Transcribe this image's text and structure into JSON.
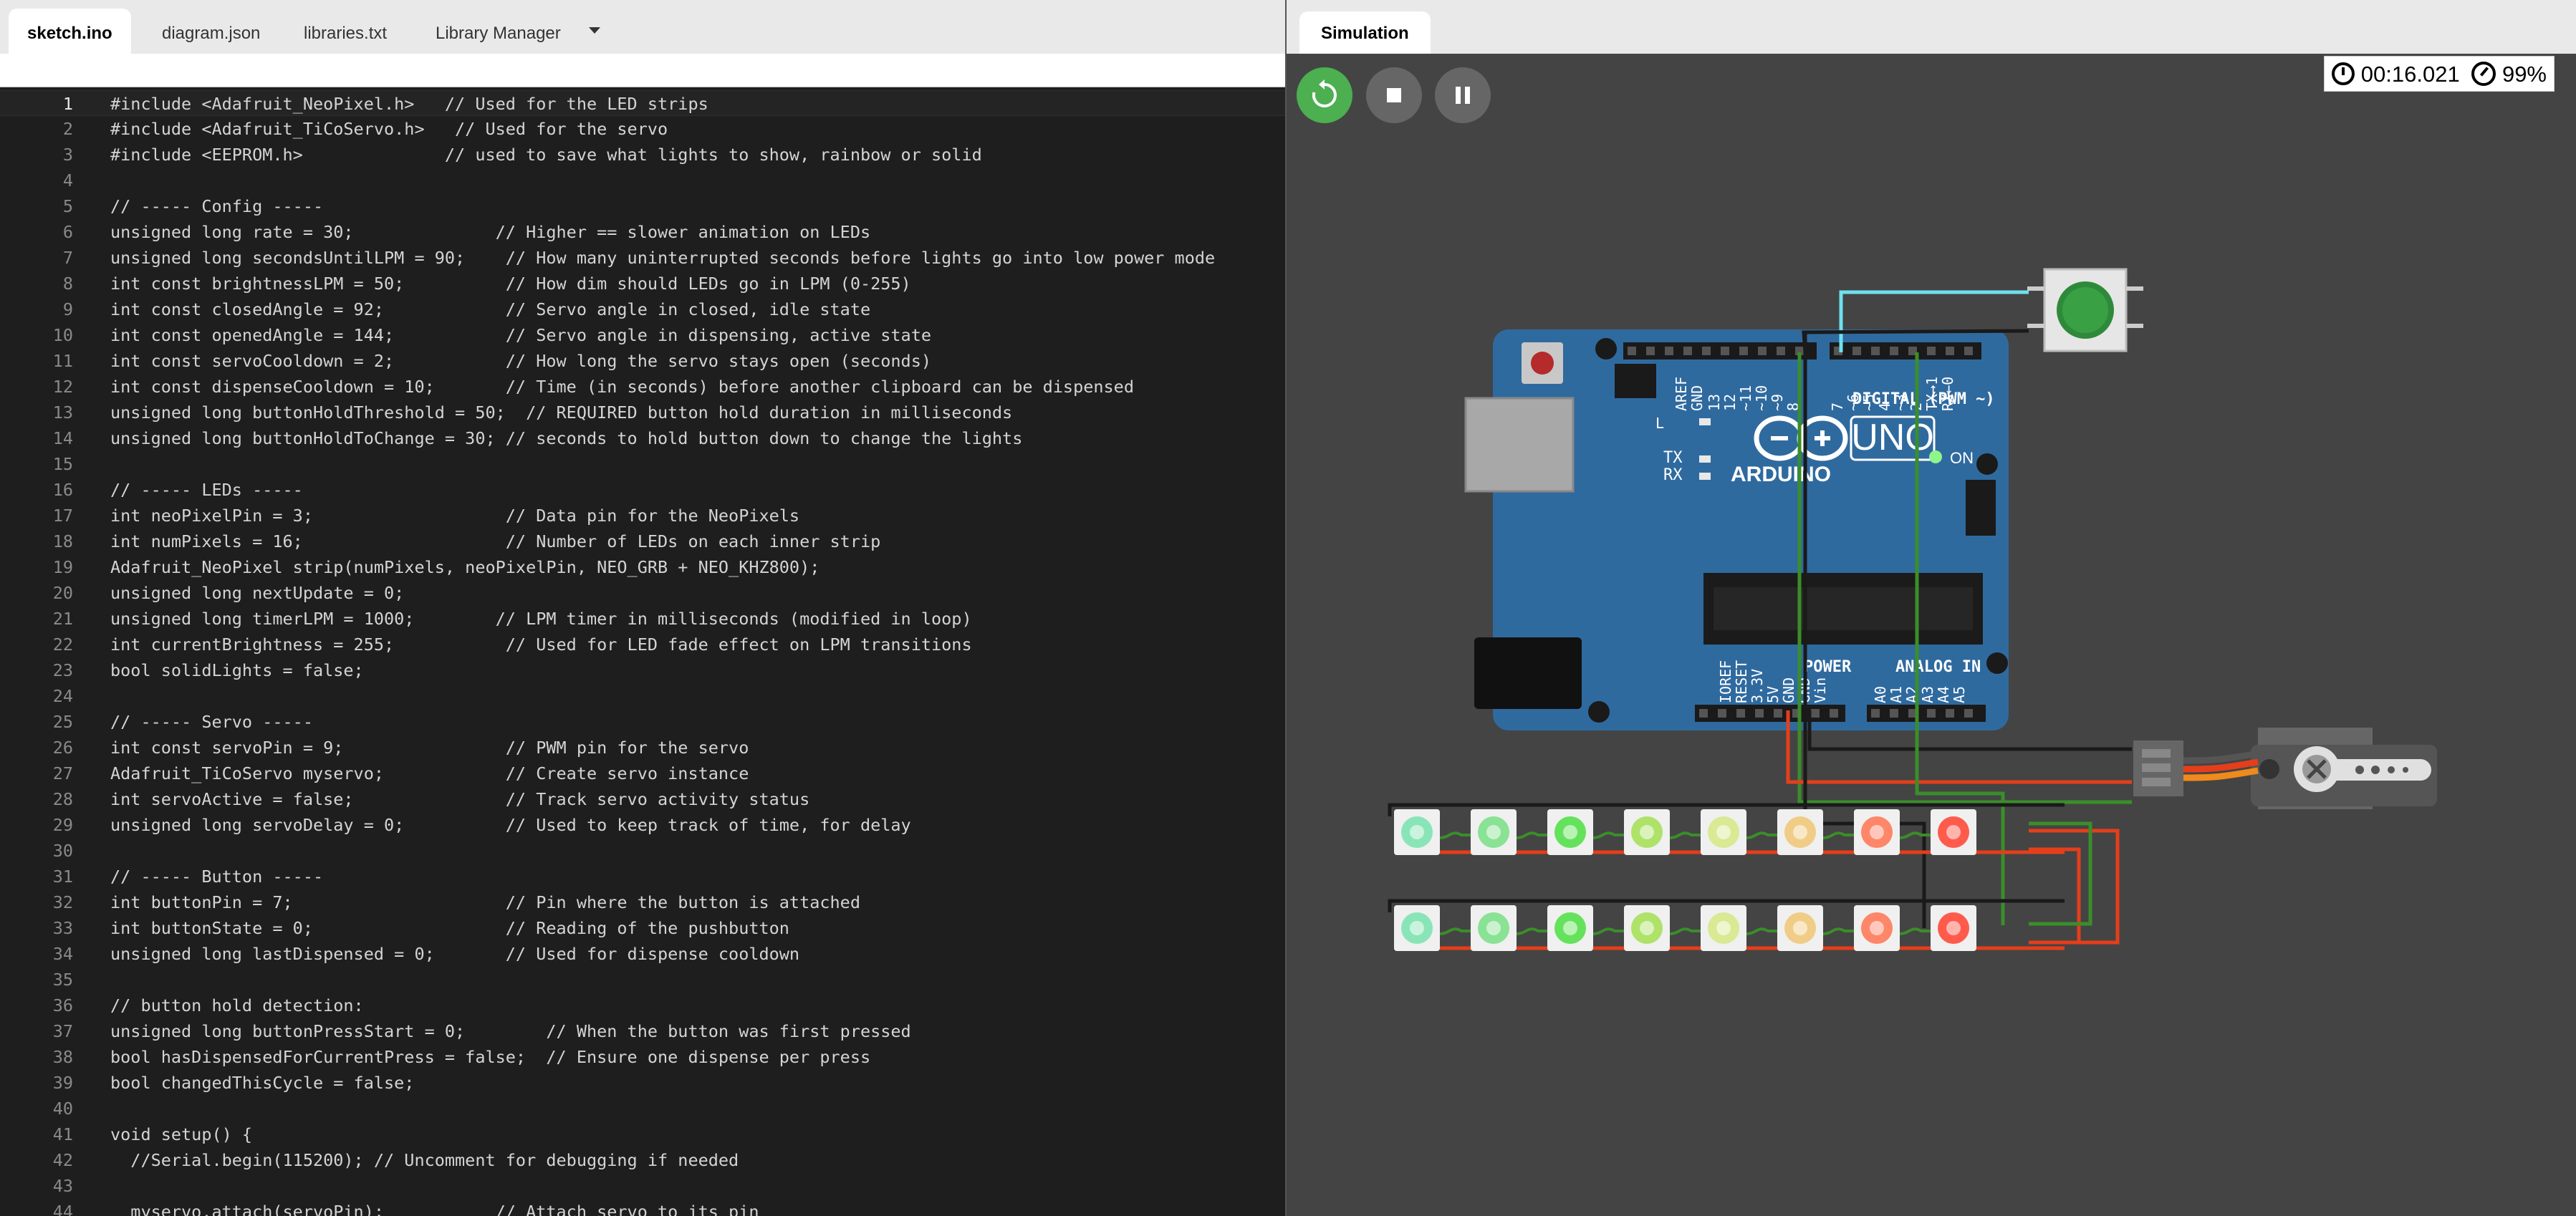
{
  "editor": {
    "tabs": [
      "sketch.ino",
      "diagram.json",
      "libraries.txt",
      "Library Manager"
    ],
    "active_tab": 0,
    "current_line": 1,
    "lines": [
      {
        "n": "1",
        "t": "#include <Adafruit_NeoPixel.h>   // Used for the LED strips"
      },
      {
        "n": "2",
        "t": "#include <Adafruit_TiCoServo.h>   // Used for the servo"
      },
      {
        "n": "3",
        "t": "#include <EEPROM.h>              // used to save what lights to show, rainbow or solid"
      },
      {
        "n": "4",
        "t": ""
      },
      {
        "n": "5",
        "t": "// ----- Config -----"
      },
      {
        "n": "6",
        "t": "unsigned long rate = 30;              // Higher == slower animation on LEDs"
      },
      {
        "n": "7",
        "t": "unsigned long secondsUntilLPM = 90;    // How many uninterrupted seconds before lights go into low power mode"
      },
      {
        "n": "8",
        "t": "int const brightnessLPM = 50;          // How dim should LEDs go in LPM (0-255)"
      },
      {
        "n": "9",
        "t": "int const closedAngle = 92;            // Servo angle in closed, idle state"
      },
      {
        "n": "10",
        "t": "int const openedAngle = 144;           // Servo angle in dispensing, active state"
      },
      {
        "n": "11",
        "t": "int const servoCooldown = 2;           // How long the servo stays open (seconds)"
      },
      {
        "n": "12",
        "t": "int const dispenseCooldown = 10;       // Time (in seconds) before another clipboard can be dispensed"
      },
      {
        "n": "13",
        "t": "unsigned long buttonHoldThreshold = 50;  // REQUIRED button hold duration in milliseconds"
      },
      {
        "n": "14",
        "t": "unsigned long buttonHoldToChange = 30; // seconds to hold button down to change the lights"
      },
      {
        "n": "15",
        "t": ""
      },
      {
        "n": "16",
        "t": "// ----- LEDs -----"
      },
      {
        "n": "17",
        "t": "int neoPixelPin = 3;                   // Data pin for the NeoPixels"
      },
      {
        "n": "18",
        "t": "int numPixels = 16;                    // Number of LEDs on each inner strip"
      },
      {
        "n": "19",
        "t": "Adafruit_NeoPixel strip(numPixels, neoPixelPin, NEO_GRB + NEO_KHZ800);"
      },
      {
        "n": "20",
        "t": "unsigned long nextUpdate = 0;"
      },
      {
        "n": "21",
        "t": "unsigned long timerLPM = 1000;        // LPM timer in milliseconds (modified in loop)"
      },
      {
        "n": "22",
        "t": "int currentBrightness = 255;           // Used for LED fade effect on LPM transitions"
      },
      {
        "n": "23",
        "t": "bool solidLights = false;"
      },
      {
        "n": "24",
        "t": ""
      },
      {
        "n": "25",
        "t": "// ----- Servo -----"
      },
      {
        "n": "26",
        "t": "int const servoPin = 9;                // PWM pin for the servo"
      },
      {
        "n": "27",
        "t": "Adafruit_TiCoServo myservo;            // Create servo instance"
      },
      {
        "n": "28",
        "t": "int servoActive = false;               // Track servo activity status"
      },
      {
        "n": "29",
        "t": "unsigned long servoDelay = 0;          // Used to keep track of time, for delay"
      },
      {
        "n": "30",
        "t": ""
      },
      {
        "n": "31",
        "t": "// ----- Button -----"
      },
      {
        "n": "32",
        "t": "int buttonPin = 7;                     // Pin where the button is attached"
      },
      {
        "n": "33",
        "t": "int buttonState = 0;                   // Reading of the pushbutton"
      },
      {
        "n": "34",
        "t": "unsigned long lastDispensed = 0;       // Used for dispense cooldown"
      },
      {
        "n": "35",
        "t": ""
      },
      {
        "n": "36",
        "t": "// button hold detection:"
      },
      {
        "n": "37",
        "t": "unsigned long buttonPressStart = 0;        // When the button was first pressed"
      },
      {
        "n": "38",
        "t": "bool hasDispensedForCurrentPress = false;  // Ensure one dispense per press"
      },
      {
        "n": "39",
        "t": "bool changedThisCycle = false;"
      },
      {
        "n": "40",
        "t": ""
      },
      {
        "n": "41",
        "t": "void setup() {"
      },
      {
        "n": "42",
        "t": "  //Serial.begin(115200); // Uncomment for debugging if needed"
      },
      {
        "n": "43",
        "t": ""
      },
      {
        "n": "44",
        "t": "  myservo.attach(servoPin);           // Attach servo to its pin"
      }
    ]
  },
  "simulation": {
    "tab": "Simulation",
    "timer": "00:16.021",
    "speed": "99%",
    "board": {
      "name": "UNO",
      "brand": "ARDUINO",
      "on_label": "ON",
      "tx": "TX",
      "rx": "RX",
      "digital_label": "DIGITAL (PWM ~)",
      "power_label": "POWER",
      "analog_label": "ANALOG IN",
      "aref": "AREF",
      "gnd": "GND",
      "l_label": "L",
      "top_pins": [
        "13",
        "12",
        "~11",
        "~10",
        "~9",
        "8"
      ],
      "top_pins2": [
        "7",
        "~6",
        "~5",
        "4",
        "~3",
        "2",
        "TX→1",
        "RX←0"
      ],
      "power_pins": [
        "IOREF",
        "RESET",
        "3.3V",
        "5V",
        "GND",
        "GND",
        "Vin"
      ],
      "analog_pins": [
        "A0",
        "A1",
        "A2",
        "A3",
        "A4",
        "A5"
      ]
    },
    "led_colors_row": [
      "#7de3b0",
      "#7ee08a",
      "#55e04a",
      "#a6e05a",
      "#d6e88a",
      "#f0c97a",
      "#ff7a5a",
      "#ff4a3a"
    ],
    "accent": "#4caf50"
  }
}
